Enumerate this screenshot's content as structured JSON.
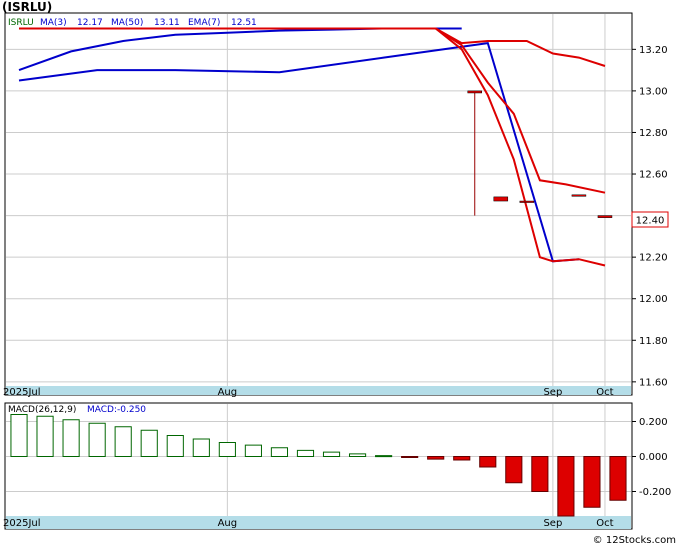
{
  "title": "(ISRLU)",
  "watermark": "© 12Stocks.com",
  "legend": {
    "symbol": "ISRLU",
    "ma3_label": "MA(3)",
    "ma3_value": "12.17",
    "ma50_label": "MA(50)",
    "ma50_value": "13.11",
    "ema7_label": "EMA(7)",
    "ema7_value": "12.51"
  },
  "macd_legend": {
    "label": "MACD(26,12,9)",
    "value_label": "MACD:-0.250"
  },
  "price_badge": "12.40",
  "colors": {
    "ma3": "#0000cc",
    "ma50": "#0000cc",
    "ema7": "#dd0000",
    "candle_down": "#dd0000",
    "macd_positive": "#006600",
    "macd_negative": "#dd0000",
    "axis_band": "#b4dde8",
    "legend_green": "#006600",
    "legend_blue": "#0000cc"
  },
  "chart_data": [
    {
      "type": "line",
      "panel": "price",
      "x_labels": [
        "2025Jul",
        "Aug",
        "Sep",
        "Oct"
      ],
      "y_ticks": [
        "13.20",
        "13.00",
        "12.80",
        "12.60",
        "12.40",
        "12.20",
        "12.00",
        "11.80",
        "11.60"
      ],
      "ylim": [
        11.58,
        13.37
      ],
      "grid": true,
      "series": [
        {
          "name": "MA(3)",
          "style": "blue",
          "x": [
            0,
            3,
            6,
            10,
            14,
            18,
            20.5,
            21.5
          ],
          "y": [
            13.05,
            13.1,
            13.1,
            13.09,
            13.16,
            13.23,
            12.18,
            12.19
          ]
        },
        {
          "name": "MA(50)",
          "style": "blue",
          "x": [
            0,
            2,
            4,
            6,
            8,
            10,
            12,
            14,
            16,
            17
          ],
          "y": [
            13.1,
            13.19,
            13.24,
            13.27,
            13.28,
            13.29,
            13.295,
            13.3,
            13.3,
            13.3
          ]
        },
        {
          "name": "EMA(7)",
          "style": "red",
          "x": [
            0,
            8,
            16,
            17,
            18,
            19.5,
            20.5,
            21.5,
            22.5
          ],
          "y": [
            13.3,
            13.3,
            13.3,
            13.23,
            13.24,
            13.24,
            13.18,
            13.16,
            13.12
          ]
        },
        {
          "name": "MA(3)",
          "style": "red",
          "x": [
            16,
            17,
            18,
            19,
            20,
            20.5
          ],
          "y": [
            13.3,
            13.2,
            12.98,
            12.67,
            12.2,
            12.18
          ]
        },
        {
          "name": "EMA(7)",
          "style": "red",
          "x": [
            16,
            17,
            18,
            19,
            20,
            21,
            22.5
          ],
          "y": [
            13.3,
            13.22,
            13.04,
            12.89,
            12.57,
            12.55,
            12.51
          ]
        },
        {
          "name": "MA(3)",
          "style": "red",
          "x": [
            20.5,
            21.5,
            22.5
          ],
          "y": [
            12.18,
            12.19,
            12.16
          ]
        }
      ],
      "candles": [
        {
          "x": 17.5,
          "open": 13.0,
          "high": 13.0,
          "low": 12.4,
          "close": 12.99
        },
        {
          "x": 18.5,
          "open": 12.49,
          "high": 12.49,
          "low": 12.47,
          "close": 12.47
        },
        {
          "x": 19.5,
          "open": 12.47,
          "high": 12.47,
          "low": 12.47,
          "close": 12.47
        },
        {
          "x": 21.5,
          "open": 12.5,
          "high": 12.5,
          "low": 12.5,
          "close": 12.5
        },
        {
          "x": 22.5,
          "open": 12.4,
          "high": 12.4,
          "low": 12.39,
          "close": 12.39
        }
      ]
    },
    {
      "type": "bar",
      "panel": "macd",
      "x_labels": [
        "2025Jul",
        "Aug",
        "Sep",
        "Oct"
      ],
      "y_ticks": [
        "0.200",
        "0.000",
        "-0.200"
      ],
      "ylim": [
        -0.34,
        0.3
      ],
      "values": [
        0.24,
        0.23,
        0.21,
        0.19,
        0.17,
        0.15,
        0.12,
        0.1,
        0.08,
        0.065,
        0.05,
        0.035,
        0.025,
        0.015,
        0.005,
        -0.005,
        -0.015,
        -0.02,
        -0.06,
        -0.15,
        -0.2,
        -0.34,
        -0.29,
        -0.25
      ]
    }
  ]
}
